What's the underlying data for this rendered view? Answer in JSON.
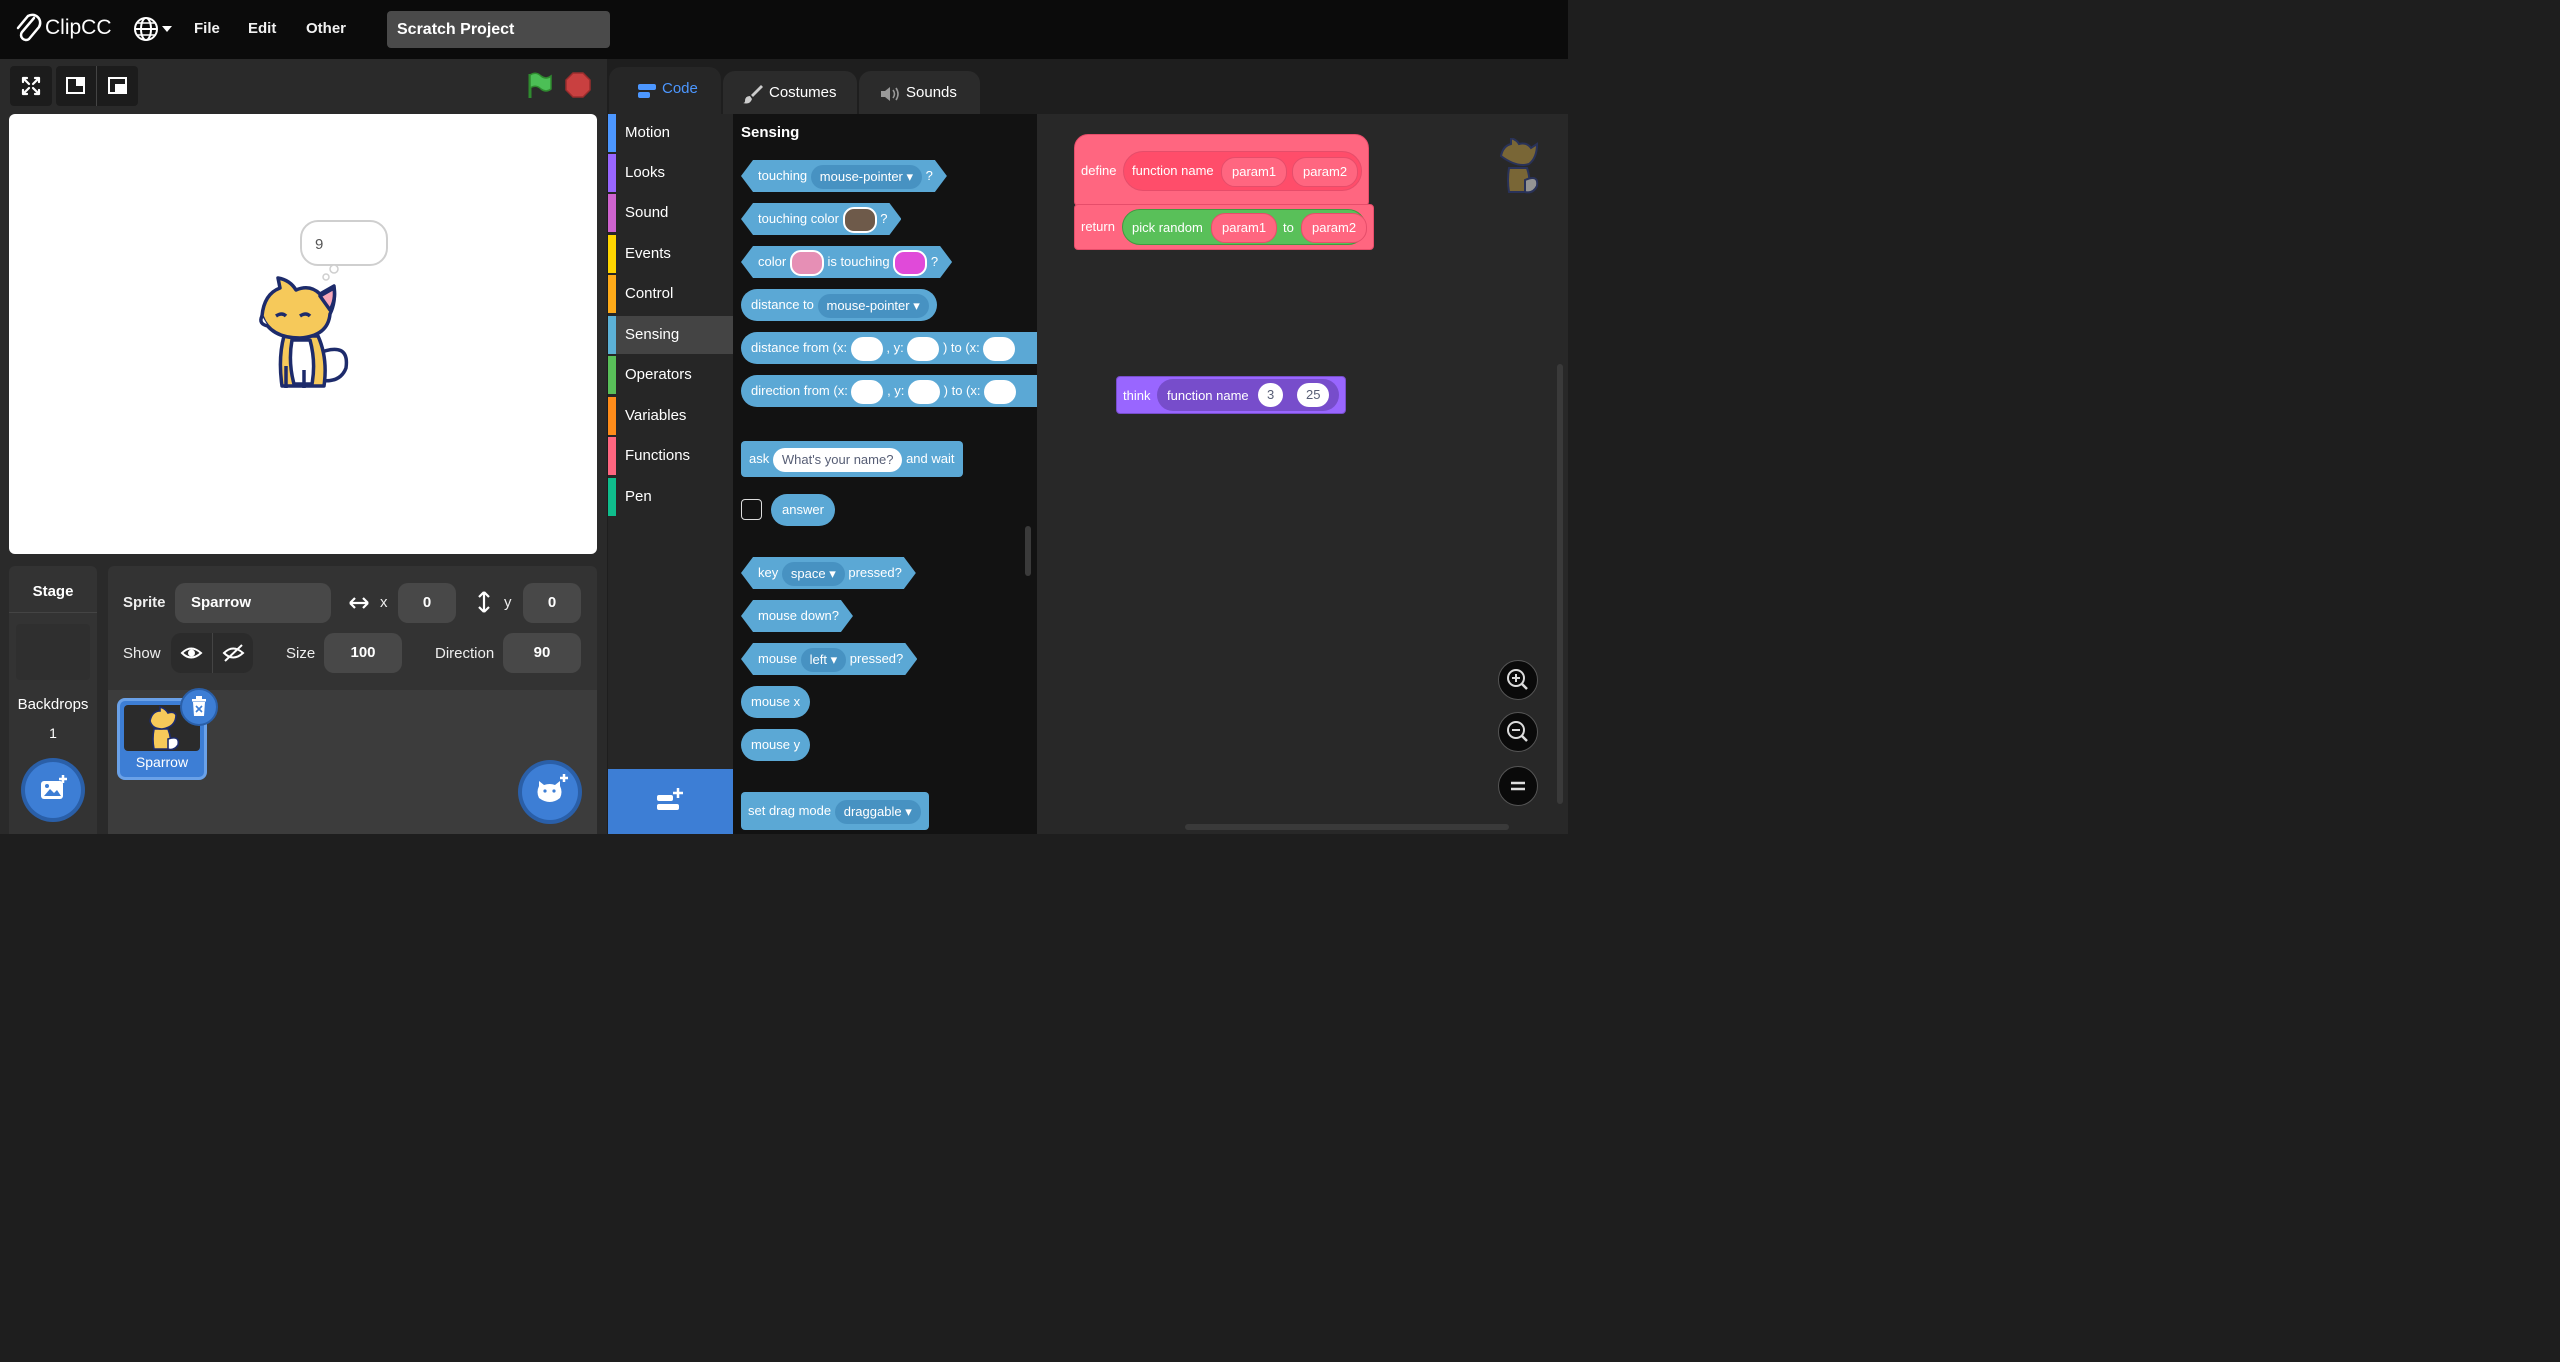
{
  "app": {
    "name": "ClipCC",
    "project_title": "Scratch Project"
  },
  "menu": {
    "file": "File",
    "edit": "Edit",
    "other": "Other"
  },
  "tabs": {
    "code": "Code",
    "costumes": "Costumes",
    "sounds": "Sounds"
  },
  "stage": {
    "bubble_text": "9"
  },
  "categories": [
    "Motion",
    "Looks",
    "Sound",
    "Events",
    "Control",
    "Sensing",
    "Operators",
    "Variables",
    "Functions",
    "Pen"
  ],
  "category_colors": [
    "#4c97ff",
    "#9966ff",
    "#cf63cf",
    "#ffd500",
    "#ffab19",
    "#5cb1d6",
    "#59c059",
    "#ff8c1a",
    "#ff6680",
    "#0fbd8c"
  ],
  "flyout": {
    "title": "Sensing",
    "touching": "touching",
    "mouse_pointer": "mouse-pointer",
    "q": "?",
    "touching_color": "touching color",
    "color": "color",
    "is_touching": "is touching",
    "distance_to": "distance to",
    "distance_from": "distance from (x:",
    "y_label": ", y:",
    "to_x": ") to (x:",
    "direction_from": "direction from (x:",
    "ask": "ask",
    "ask_default": "What's your name?",
    "and_wait": "and wait",
    "answer": "answer",
    "key": "key",
    "space": "space",
    "pressed": "pressed?",
    "mouse_down": "mouse down?",
    "mouse": "mouse",
    "left": "left",
    "mouse_x": "mouse x",
    "mouse_y": "mouse y",
    "set_drag_mode": "set drag mode",
    "draggable": "draggable"
  },
  "script": {
    "define": "define",
    "function_name": "function name",
    "param1": "param1",
    "param2": "param2",
    "return": "return",
    "pick_random": "pick random",
    "to": "to",
    "think": "think",
    "arg1": "3",
    "arg2": "25"
  },
  "sprite_info": {
    "sprite_label": "Sprite",
    "sprite_name": "Sparrow",
    "x_label": "x",
    "x_value": "0",
    "y_label": "y",
    "y_value": "0",
    "show_label": "Show",
    "size_label": "Size",
    "size_value": "100",
    "direction_label": "Direction",
    "direction_value": "90"
  },
  "stage_panel": {
    "title": "Stage",
    "backdrops_label": "Backdrops",
    "backdrops_count": "1"
  },
  "sprite_list": [
    {
      "name": "Sparrow"
    }
  ]
}
